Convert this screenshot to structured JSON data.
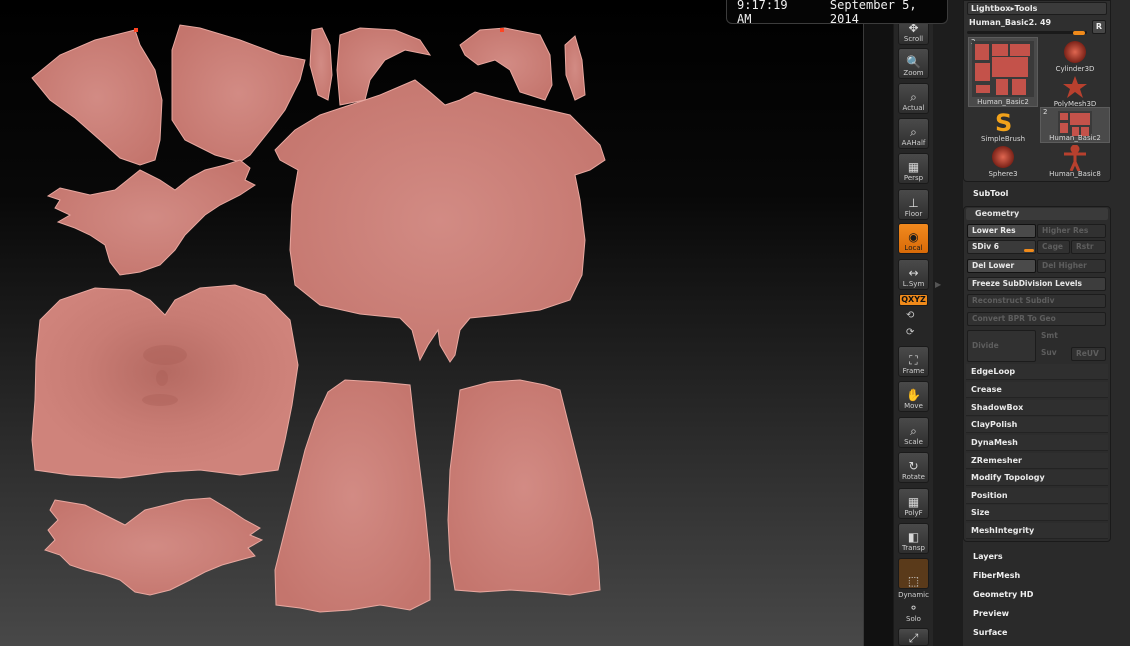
{
  "status_bar": {
    "time": "9:17:19 AM",
    "date": "September 5, 2014"
  },
  "shelf": {
    "scroll": "Scroll",
    "zoom": "Zoom",
    "actual": "Actual",
    "aahalf": "AAHalf",
    "persp": "Persp",
    "floor": "Floor",
    "local": "Local",
    "lsym": "L.Sym",
    "xyz": "QXYZ",
    "frame": "Frame",
    "move": "Move",
    "scale": "Scale",
    "rotate": "Rotate",
    "polyf": "PolyF",
    "transp": "Transp",
    "dynamic": "Dynamic",
    "solo": "Solo",
    "accent_color": "#f08a1a"
  },
  "tool_panel": {
    "lightbox_tools": "Lightbox▸Tools",
    "current_tool": "Human_Basic2. 49",
    "r_button": "R",
    "tools": [
      {
        "name": "Human_Basic2",
        "count": "2"
      },
      {
        "name": "Cylinder3D",
        "count": ""
      },
      {
        "name": "PolyMesh3D",
        "count": ""
      },
      {
        "name": "SimpleBrush",
        "count": ""
      },
      {
        "name": "Human_Basic2",
        "count": "2"
      },
      {
        "name": "Sphere3",
        "count": ""
      },
      {
        "name": "Human_Basic8",
        "count": ""
      }
    ]
  },
  "menu": {
    "subtool": "SubTool",
    "geometry": {
      "title": "Geometry",
      "lower_res": "Lower Res",
      "higher_res": "Higher Res",
      "sdiv": "SDiv 6",
      "cage": "Cage",
      "rstr": "Rstr",
      "del_lower": "Del Lower",
      "del_higher": "Del Higher",
      "freeze": "Freeze SubDivision Levels",
      "reconstruct": "Reconstruct Subdiv",
      "convert_bpr": "Convert BPR To Geo",
      "divide": "Divide",
      "smt": "Smt",
      "suv": "Suv",
      "reuv": "ReUV",
      "items": [
        "EdgeLoop",
        "Crease",
        "ShadowBox",
        "ClayPolish",
        "DynaMesh",
        "ZRemesher",
        "Modify Topology",
        "Position",
        "Size",
        "MeshIntegrity"
      ]
    },
    "sections": [
      "Layers",
      "FiberMesh",
      "Geometry HD",
      "Preview",
      "Surface"
    ]
  }
}
